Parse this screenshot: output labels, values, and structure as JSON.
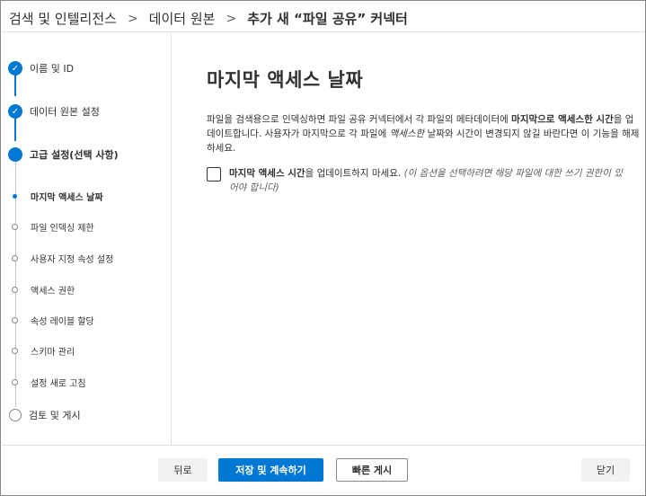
{
  "breadcrumb": {
    "items": [
      "검색 및 인텔리전스",
      "데이터 원본",
      "추가 새 “파일 공유” 커넥터"
    ],
    "separator": ">"
  },
  "nav": {
    "steps": [
      {
        "label": "이름 및 ID",
        "state": "done"
      },
      {
        "label": "데이터 원본 설정",
        "state": "done"
      },
      {
        "label": "고급 설정(선택 사항)",
        "state": "current"
      },
      {
        "label": "검토 및 게시",
        "state": "todo"
      }
    ],
    "substeps": [
      {
        "label": "마지막 액세스 날짜",
        "active": true
      },
      {
        "label": "파일 인덱싱 제한",
        "active": false
      },
      {
        "label": "사용자 지정 속성 설정",
        "active": false
      },
      {
        "label": "액세스 권한",
        "active": false
      },
      {
        "label": "속성 레이블 할당",
        "active": false
      },
      {
        "label": "스키마 관리",
        "active": false
      },
      {
        "label": "설정 새로 고침",
        "active": false
      }
    ]
  },
  "main": {
    "title": "마지막 액세스 날짜",
    "desc_1": "파일을 검색용으로 인덱싱하면 파일 공유 커넥터에서 각 파일의 메타데이터에 ",
    "desc_bold": "마지막으로 액세스한 시간",
    "desc_2": "을 업데이트합니다. 사용자가 마지막으로 각 파일에 ",
    "desc_italic": "액세스한",
    "desc_3": " 날짜와 시간이 변경되지 않길 바란다면 이 기능을 해제하세요.",
    "checkbox_bold": "마지막 액세스 시간",
    "checkbox_text": "을 업데이트하지 마세요.",
    "checkbox_note": "(이 옵션을 선택하려면 해당 파일에 대한 쓰기 권한이 있어야 합니다)",
    "checkbox_checked": false
  },
  "footer": {
    "back": "뒤로",
    "save_continue": "저장 및 계속하기",
    "quick_publish": "빠른 게시",
    "close": "닫기"
  },
  "colors": {
    "accent": "#0078d4",
    "border": "#e1dfdd"
  },
  "icons": {
    "step_done": "check-icon"
  }
}
